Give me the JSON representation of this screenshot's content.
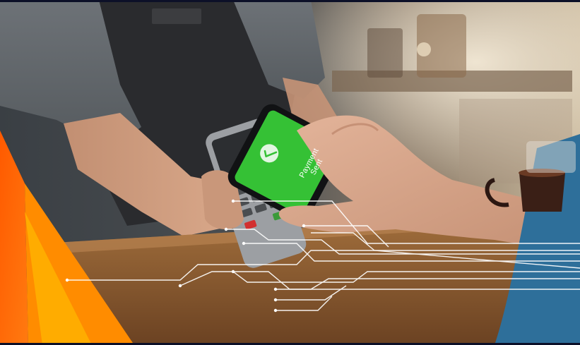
{
  "phone_screen": {
    "line1": "Payment",
    "line2": "Sent",
    "icon": "checkmark-circle-icon",
    "screen_color": "#35c135"
  },
  "colors": {
    "accent_orange": "#ff6a00",
    "accent_yellow": "#ffb400",
    "circuit_lines": "#ffffff",
    "frame_border": "#0c1028"
  }
}
